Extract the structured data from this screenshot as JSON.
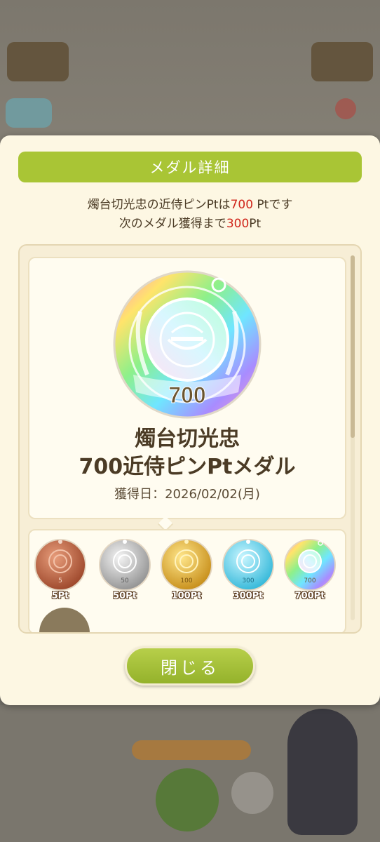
{
  "dialog": {
    "title": "メダル詳細",
    "line1_prefix": "燭台切光忠の近侍ピンPtは",
    "line1_points": "700",
    "line1_suffix": " Ptです",
    "line2_prefix": "次のメダル獲得まで",
    "line2_points": "300",
    "line2_suffix": "Pt",
    "close_label": "閉じる"
  },
  "detail": {
    "medal_number": "700",
    "name_line1": "燭台切光忠",
    "name_line2": "700近侍ピンPtメダル",
    "date_text": "獲得日：2026/02/02(月)"
  },
  "medals": [
    {
      "number": "5",
      "label": "5Pt",
      "tier": "bronze"
    },
    {
      "number": "50",
      "label": "50Pt",
      "tier": "silver"
    },
    {
      "number": "100",
      "label": "100Pt",
      "tier": "gold"
    },
    {
      "number": "300",
      "label": "300Pt",
      "tier": "aqua"
    },
    {
      "number": "700",
      "label": "700Pt",
      "tier": "rainbow"
    }
  ],
  "colors": {
    "accent_green": "#a9c535",
    "highlight_red": "#d0261b",
    "text_brown": "#4b3b25"
  }
}
